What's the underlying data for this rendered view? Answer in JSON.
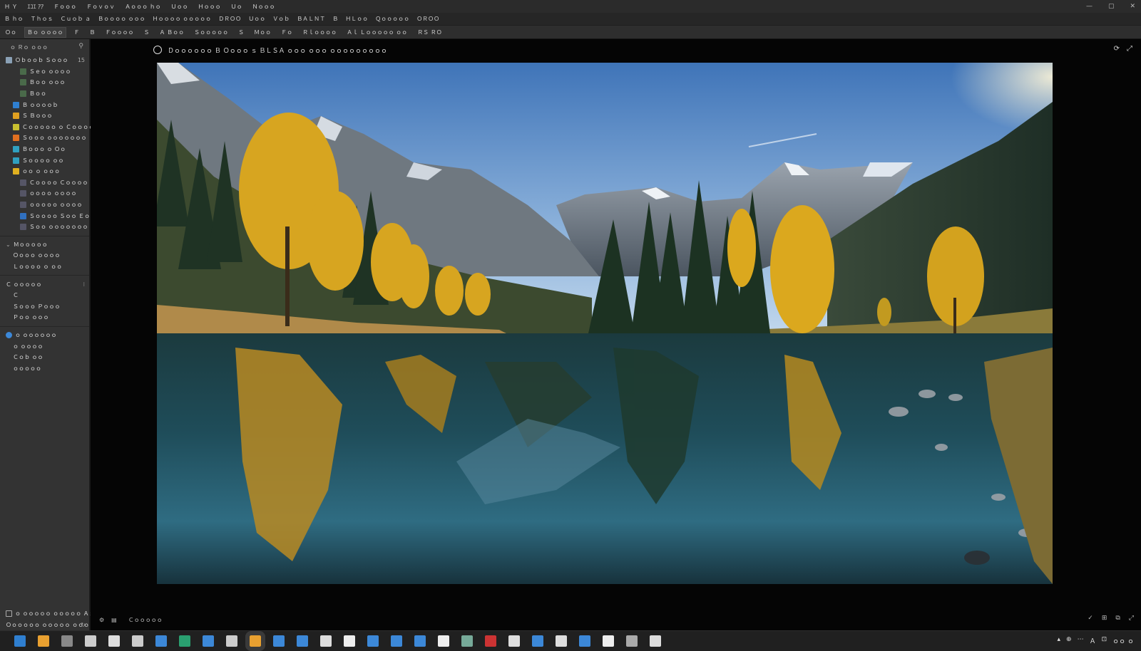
{
  "menubar": {
    "items": [
      "Ｈ Ｙ",
      "ｴｺｴ ｱｱ",
      "Ｆｏｏｏ",
      "Ｆｏｖｏｖ",
      "Ａｏｏｏ ｈｏ",
      "Ｕｏｏ",
      "Ｈｏｏｏ",
      "Ｕｏ",
      "Ｎｏｏｏ"
    ],
    "window_controls": [
      "—",
      "▢",
      "✕"
    ]
  },
  "toolbar1": {
    "items": [
      "Ｂ ｈｏ",
      "Ｔｈｏｓ",
      "Ｃｕｏｂ ａ",
      "Ｂｏｏｏｏ ｏｏｏ",
      "Ｈｏｏｏｏ ｏｏｏｏｏ",
      "ＤＲＯＯ",
      "Ｕｏｏ",
      "Ｖｏｂ",
      "ＢＡＬＮＴ",
      "Ｂ",
      "ＨＬｏｏ",
      "Ｑｏｏｏｏｏ",
      "ＯＲＯＯ"
    ]
  },
  "toolbar2": {
    "items": [
      "Ｏｏ",
      "Ｂｏ ｏｏｏｏ",
      "Ｆ",
      "Ｂ",
      "Ｆｏｏｏｏ",
      "Ｓ",
      "Ａ Ｂｏｏ",
      "Ｓｏｏｏｏｏ",
      "Ｓ",
      "Ｍｏｏ",
      "Ｆｏ",
      "Ｒｌｏｏｏｏ",
      "Ａｌ Ｌｏｏｏｏｏ ｏｏ",
      "ＲＳ ＲＯ"
    ]
  },
  "sidebar": {
    "header": "ｏ Ｒｏ ｏｏｏ",
    "rows": [
      {
        "label": "Ｏｂｏｏｂ Ｓｏｏｏ",
        "indent": 0,
        "color": "#8aa0b5",
        "count": "15"
      },
      {
        "label": "Ｓｅｏ ｏｏｏｏ",
        "indent": 2,
        "color": "#4a6a4a",
        "count": ""
      },
      {
        "label": "Ｂｏｏ ｏｏｏ",
        "indent": 2,
        "color": "#4a6a4a",
        "count": ""
      },
      {
        "label": "Ｂｏｏ",
        "indent": 2,
        "color": "#4a6a4a",
        "count": ""
      },
      {
        "label": "Ｂ ｏｏｏｏｂ",
        "indent": 1,
        "color": "#2f7fd0",
        "count": ""
      },
      {
        "label": "Ｓ Ｂｏｏｏ",
        "indent": 1,
        "color": "#e0a020",
        "count": ""
      },
      {
        "label": "Ｃｏｏｏｏｏ ｏ Ｃｏｏｏｏ",
        "indent": 1,
        "color": "#c8c030",
        "count": ""
      },
      {
        "label": "Ｓｏｏｏ ｏｏｏｏｏｏｏ",
        "indent": 1,
        "color": "#e07020",
        "count": ""
      },
      {
        "label": "Ｂｏｏｏ ｏ Ｏｏ",
        "indent": 1,
        "color": "#30a0c0",
        "count": ""
      },
      {
        "label": "Ｓｏｏｏｏ ｏｏ",
        "indent": 1,
        "color": "#30a0c0",
        "count": ""
      },
      {
        "label": "ｏｏ ｏ ｏｏｏ",
        "indent": 1,
        "color": "#e0b020",
        "count": ""
      },
      {
        "label": "Ｃｏｏｏｏ Ｃｏｏｏｏ",
        "indent": 2,
        "color": "#556",
        "count": ""
      },
      {
        "label": "ｏｏｏｏ ｏｏｏｏ",
        "indent": 2,
        "color": "#556",
        "count": ""
      },
      {
        "label": "ｏｏｏｏｏ ｏｏｏｏ",
        "indent": 2,
        "color": "#556",
        "count": ""
      },
      {
        "label": "Ｓｏｏｏｏ Ｓｏｏ Ｅｏｏ",
        "indent": 2,
        "color": "#3070c0",
        "count": ""
      },
      {
        "label": "Ｓｏｏ ｏｏｏｏｏｏｏ",
        "indent": 2,
        "color": "#556",
        "count": ""
      }
    ],
    "section2_header": "Ｍｏｏｏｏｏ",
    "section2_rows": [
      "Ｏｏｏｏ ｏｏｏｏ",
      "Ｌｏｏｏｏ ｏ ｏｏ"
    ],
    "section3_header": "Ｃ ｏｏｏｏｏ",
    "section3_rows": [
      "Ｃ",
      "Ｓｏｏｏ Ｐｏｏｏ",
      "Ｐｏｏ ｏｏｏ"
    ],
    "section4_header": "ｏ ｏｏｏｏｏｏ",
    "section4_rows": [
      "ｏ ｏｏｏｏ",
      "Ｃｏｂ ｏｏ",
      "ｏｏｏｏｏ"
    ],
    "footer": [
      "ｏ ｏｏｏｏｏ ｏｏｏｏｏ Ａｓ",
      "Ｏｏｏｏｏｏ ｏｏｏｏｏ ｏｏｏ"
    ]
  },
  "viewer": {
    "title": "Ｄｏｏｏｏｏｏ Ｂ Ｏｏｏｏ ｓ ＢＬＳＡ ｏｏｏ ｏｏｏ ｏｏｏｏｏｏｏｏｏ",
    "top_icons": [
      "⟳",
      "⤢"
    ],
    "bottom_label": "Ｃｏｏｏｏｏ",
    "bottom_icons": [
      "✓",
      "⊞",
      "⧉",
      "⤢"
    ]
  },
  "taskbar": {
    "tray": [
      "▴",
      "⊕",
      "⋯",
      "Ａ",
      "⊡",
      "ｏｏ ｏ"
    ]
  },
  "colors": {
    "bg": "#1a1a1a",
    "panel": "#333333",
    "viewer_bg": "#050505",
    "accent": "#3c88d8"
  }
}
